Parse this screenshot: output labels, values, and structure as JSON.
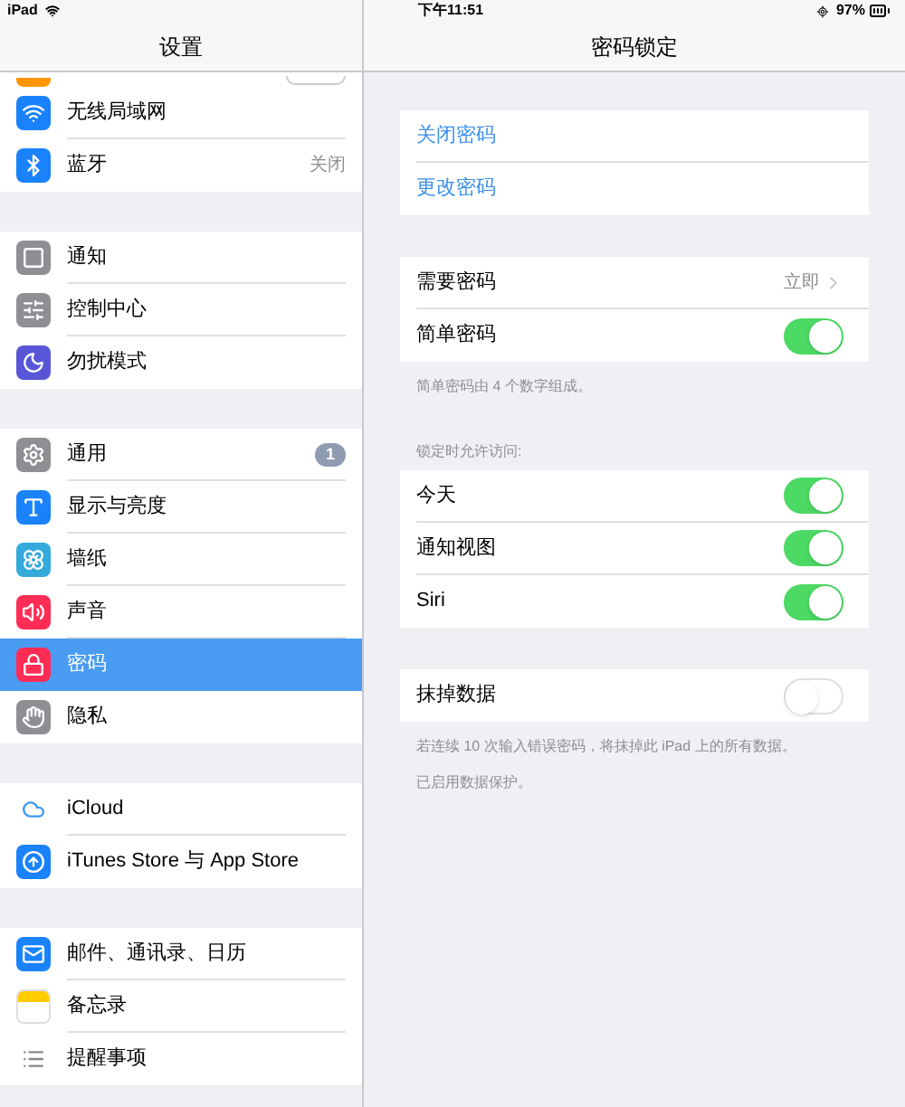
{
  "status_bar": {
    "device": "iPad",
    "time": "下午11:51",
    "battery": "97%"
  },
  "sidebar": {
    "title": "设置",
    "groups": [
      [
        {
          "label": "无线局域网",
          "selected": false
        },
        {
          "label": "蓝牙",
          "value": "关闭",
          "selected": false
        }
      ],
      [
        {
          "label": "通知",
          "selected": false
        },
        {
          "label": "控制中心",
          "selected": false
        },
        {
          "label": "勿扰模式",
          "selected": false
        }
      ],
      [
        {
          "label": "通用",
          "badge": "1",
          "selected": false
        },
        {
          "label": "显示与亮度",
          "selected": false
        },
        {
          "label": "墙纸",
          "selected": false
        },
        {
          "label": "声音",
          "selected": false
        },
        {
          "label": "密码",
          "selected": true
        },
        {
          "label": "隐私",
          "selected": false
        }
      ],
      [
        {
          "label": "iCloud",
          "selected": false
        },
        {
          "label": "iTunes Store 与 App Store",
          "selected": false
        }
      ],
      [
        {
          "label": "邮件、通讯录、日历",
          "selected": false
        },
        {
          "label": "备忘录",
          "selected": false
        },
        {
          "label": "提醒事项",
          "selected": false
        }
      ]
    ]
  },
  "detail": {
    "title": "密码锁定",
    "sections": [
      {
        "rows": [
          {
            "kind": "link",
            "label": "关闭密码"
          },
          {
            "kind": "link",
            "label": "更改密码"
          }
        ]
      },
      {
        "rows": [
          {
            "kind": "value",
            "label": "需要密码",
            "value": "立即"
          },
          {
            "kind": "switch",
            "label": "简单密码",
            "on": true
          }
        ],
        "footer": [
          "简单密码由 4 个数字组成。"
        ]
      },
      {
        "header": "锁定时允许访问:",
        "rows": [
          {
            "kind": "switch",
            "label": "今天",
            "on": true
          },
          {
            "kind": "switch",
            "label": "通知视图",
            "on": true
          },
          {
            "kind": "switch",
            "label": "Siri",
            "on": true
          }
        ]
      },
      {
        "rows": [
          {
            "kind": "switch",
            "label": "抹掉数据",
            "on": false
          }
        ],
        "footer": [
          "若连续 10 次输入错误密码，将抹掉此 iPad 上的所有数据。",
          "已启用数据保护。"
        ]
      }
    ]
  }
}
